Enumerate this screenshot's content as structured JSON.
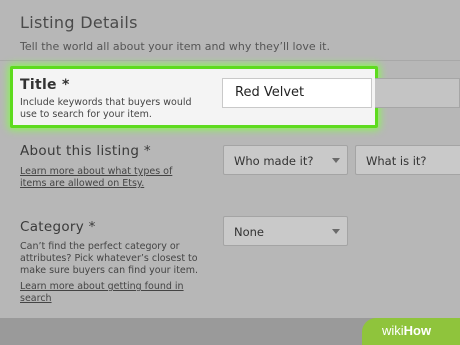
{
  "section": {
    "title": "Listing Details",
    "subtitle": "Tell the world all about your item and why they’ll love it."
  },
  "title_field": {
    "label": "Title *",
    "help": "Include keywords that buyers would use to search for your item.",
    "value": "Red Velvet"
  },
  "about": {
    "label": "About this listing *",
    "link": "Learn more about what types of items are allowed on Etsy.",
    "who_made": "Who made it?",
    "what_is": "What is it?"
  },
  "category": {
    "label": "Category *",
    "help": "Can’t find the perfect category or attributes? Pick whatever’s closest to make sure buyers can find your item.",
    "link": "Learn more about getting found in search",
    "selected": "None"
  },
  "watermark": {
    "prefix": "wiki",
    "suffix": "How"
  },
  "colors": {
    "highlight": "#5edb1e",
    "watermark": "#8fc43c"
  }
}
